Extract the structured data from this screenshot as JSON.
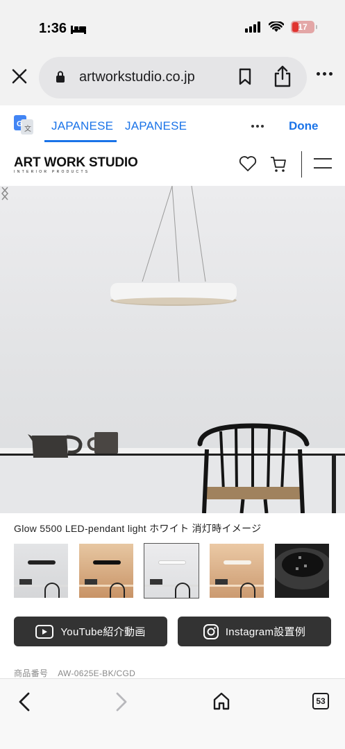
{
  "status_bar": {
    "time": "1:36",
    "battery": "17"
  },
  "browser": {
    "url": "artworkstudio.co.jp",
    "tabs_count": "53"
  },
  "translate_bar": {
    "source_lang": "JAPANESE",
    "target_lang": "JAPANESE",
    "done_label": "Done"
  },
  "site_header": {
    "logo_main": "ART WORK STUDIO",
    "logo_sub": "INTERIOR PRODUCTS"
  },
  "product": {
    "caption": "Glow 5500 LED-pendant light ホワイト 消灯時イメージ",
    "youtube_label": "YouTube紹介動画",
    "instagram_label": "Instagram設置例",
    "sku_label": "商品番号",
    "sku_value": "AW-0625E-BK/CGD"
  },
  "colors": {
    "accent": "#1a73e8",
    "button_bg": "#333333"
  }
}
